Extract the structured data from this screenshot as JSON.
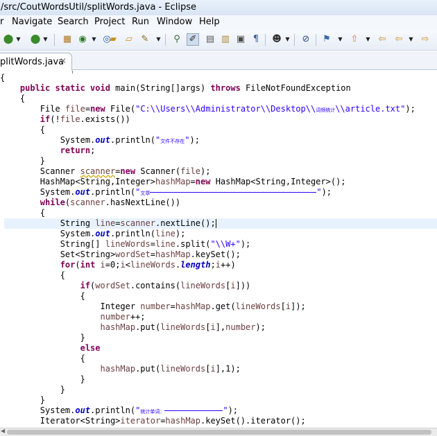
{
  "window": {
    "title": "/src/CoutWordsUtil/splitWords.java - Eclipse"
  },
  "menubar": {
    "items": [
      {
        "label": "r"
      },
      {
        "label": "Navigate"
      },
      {
        "label": "Search"
      },
      {
        "label": "Project"
      },
      {
        "label": "Run"
      },
      {
        "label": "Window"
      },
      {
        "label": "Help"
      }
    ]
  },
  "toolbar": {
    "icons": [
      "new-package-icon",
      "debug-icon",
      "run-icon",
      "new-java-project-icon",
      "new-class-icon",
      "open-folder-icon",
      "open-type-icon",
      "external-tools-icon",
      "toggle-breakpoint-icon",
      "mark-occurrences-icon",
      "open-resource-icon",
      "show-whitespace-icon",
      "block-selection-icon",
      "user-icon",
      "skip-breakpoints-icon",
      "pin-icon",
      "next-annotation-icon",
      "previous-annotation-icon",
      "back-icon",
      "forward-icon"
    ]
  },
  "tab": {
    "label": "plitWords.java",
    "close_glyph": "✕"
  },
  "code": {
    "lines": [
      [
        {
          "t": "{",
          "c": ""
        }
      ],
      [
        {
          "t": "    ",
          "c": ""
        },
        {
          "t": "public static void",
          "c": "kw"
        },
        {
          "t": " main(String[]args) ",
          "c": ""
        },
        {
          "t": "throws",
          "c": "kw"
        },
        {
          "t": " FileNotFoundException",
          "c": ""
        }
      ],
      [
        {
          "t": "    {",
          "c": ""
        }
      ],
      [
        {
          "t": "        File ",
          "c": ""
        },
        {
          "t": "file",
          "c": "var"
        },
        {
          "t": "=",
          "c": ""
        },
        {
          "t": "new",
          "c": "kw"
        },
        {
          "t": " File(",
          "c": ""
        },
        {
          "t": "\"C:\\\\Users\\\\Administrator\\\\Desktop\\\\",
          "c": "str"
        },
        {
          "t": "词频统计",
          "c": "str cjk"
        },
        {
          "t": "\\\\article.txt\"",
          "c": "str"
        },
        {
          "t": ");",
          "c": ""
        }
      ],
      [
        {
          "t": "        ",
          "c": ""
        },
        {
          "t": "if",
          "c": "kw"
        },
        {
          "t": "(!",
          "c": ""
        },
        {
          "t": "file",
          "c": "var"
        },
        {
          "t": ".exists())",
          "c": ""
        }
      ],
      [
        {
          "t": "        {",
          "c": ""
        }
      ],
      [
        {
          "t": "            System.",
          "c": ""
        },
        {
          "t": "out",
          "c": "fld"
        },
        {
          "t": ".println(",
          "c": ""
        },
        {
          "t": "\"",
          "c": "str"
        },
        {
          "t": "文件不存在",
          "c": "str cjk"
        },
        {
          "t": "\"",
          "c": "str"
        },
        {
          "t": ");",
          "c": ""
        }
      ],
      [
        {
          "t": "            ",
          "c": ""
        },
        {
          "t": "return",
          "c": "kw"
        },
        {
          "t": ";",
          "c": ""
        }
      ],
      [
        {
          "t": "        }",
          "c": ""
        }
      ],
      [
        {
          "t": "        Scanner ",
          "c": ""
        },
        {
          "t": "scanner",
          "c": "uvar"
        },
        {
          "t": "=",
          "c": ""
        },
        {
          "t": "new",
          "c": "kw"
        },
        {
          "t": " Scanner(",
          "c": ""
        },
        {
          "t": "file",
          "c": "var"
        },
        {
          "t": ");",
          "c": ""
        }
      ],
      [
        {
          "t": "        HashMap<String,Integer>",
          "c": ""
        },
        {
          "t": "hashMap",
          "c": "var"
        },
        {
          "t": "=",
          "c": ""
        },
        {
          "t": "new",
          "c": "kw"
        },
        {
          "t": " HashMap<String,Integer>();",
          "c": ""
        }
      ],
      [
        {
          "t": "        System.",
          "c": ""
        },
        {
          "t": "out",
          "c": "fld"
        },
        {
          "t": ".println(",
          "c": ""
        },
        {
          "t": "\"",
          "c": "str"
        },
        {
          "t": "文章",
          "c": "str cjk"
        },
        {
          "t": "",
          "c": "dash",
          "w": 240
        },
        {
          "t": "\"",
          "c": "str"
        },
        {
          "t": ");",
          "c": ""
        }
      ],
      [
        {
          "t": "        ",
          "c": ""
        },
        {
          "t": "while",
          "c": "kw"
        },
        {
          "t": "(",
          "c": ""
        },
        {
          "t": "scanner",
          "c": "var"
        },
        {
          "t": ".hasNextLine())",
          "c": ""
        }
      ],
      [
        {
          "t": "        {",
          "c": ""
        }
      ],
      [
        {
          "t": "            String ",
          "c": ""
        },
        {
          "t": "line",
          "c": "var"
        },
        {
          "t": "=",
          "c": ""
        },
        {
          "t": "scanner",
          "c": "var"
        },
        {
          "t": ".nextLine();",
          "c": ""
        },
        {
          "t": "",
          "c": "caret"
        }
      ],
      [
        {
          "t": "            System.",
          "c": ""
        },
        {
          "t": "out",
          "c": "fld"
        },
        {
          "t": ".println(",
          "c": ""
        },
        {
          "t": "line",
          "c": "var"
        },
        {
          "t": ");",
          "c": ""
        }
      ],
      [
        {
          "t": "            String[] ",
          "c": ""
        },
        {
          "t": "lineWords",
          "c": "var"
        },
        {
          "t": "=",
          "c": ""
        },
        {
          "t": "line",
          "c": "var"
        },
        {
          "t": ".split(",
          "c": ""
        },
        {
          "t": "\"\\\\W+\"",
          "c": "str"
        },
        {
          "t": ");",
          "c": ""
        }
      ],
      [
        {
          "t": "            Set<String>",
          "c": ""
        },
        {
          "t": "wordSet",
          "c": "var"
        },
        {
          "t": "=",
          "c": ""
        },
        {
          "t": "hashMap",
          "c": "var"
        },
        {
          "t": ".keySet();",
          "c": ""
        }
      ],
      [
        {
          "t": "            ",
          "c": ""
        },
        {
          "t": "for",
          "c": "kw"
        },
        {
          "t": "(",
          "c": ""
        },
        {
          "t": "int",
          "c": "kw"
        },
        {
          "t": " ",
          "c": ""
        },
        {
          "t": "i",
          "c": "var"
        },
        {
          "t": "=0;",
          "c": ""
        },
        {
          "t": "i",
          "c": "var"
        },
        {
          "t": "<",
          "c": ""
        },
        {
          "t": "lineWords",
          "c": "var"
        },
        {
          "t": ".",
          "c": ""
        },
        {
          "t": "length",
          "c": "fld"
        },
        {
          "t": ";",
          "c": ""
        },
        {
          "t": "i",
          "c": "var"
        },
        {
          "t": "++)",
          "c": ""
        }
      ],
      [
        {
          "t": "            {",
          "c": ""
        }
      ],
      [
        {
          "t": "                ",
          "c": ""
        },
        {
          "t": "if",
          "c": "kw"
        },
        {
          "t": "(",
          "c": ""
        },
        {
          "t": "wordSet",
          "c": "var"
        },
        {
          "t": ".contains(",
          "c": ""
        },
        {
          "t": "lineWords",
          "c": "var"
        },
        {
          "t": "[",
          "c": ""
        },
        {
          "t": "i",
          "c": "var"
        },
        {
          "t": "]))",
          "c": ""
        }
      ],
      [
        {
          "t": "                {",
          "c": ""
        }
      ],
      [
        {
          "t": "                    Integer ",
          "c": ""
        },
        {
          "t": "number",
          "c": "var"
        },
        {
          "t": "=",
          "c": ""
        },
        {
          "t": "hashMap",
          "c": "var"
        },
        {
          "t": ".get(",
          "c": ""
        },
        {
          "t": "lineWords",
          "c": "var"
        },
        {
          "t": "[",
          "c": ""
        },
        {
          "t": "i",
          "c": "var"
        },
        {
          "t": "]);",
          "c": ""
        }
      ],
      [
        {
          "t": "                    ",
          "c": ""
        },
        {
          "t": "number",
          "c": "var"
        },
        {
          "t": "++;",
          "c": ""
        }
      ],
      [
        {
          "t": "                    ",
          "c": ""
        },
        {
          "t": "hashMap",
          "c": "var"
        },
        {
          "t": ".put(",
          "c": ""
        },
        {
          "t": "lineWords",
          "c": "var"
        },
        {
          "t": "[",
          "c": ""
        },
        {
          "t": "i",
          "c": "var"
        },
        {
          "t": "],",
          "c": ""
        },
        {
          "t": "number",
          "c": "var"
        },
        {
          "t": ");",
          "c": ""
        }
      ],
      [
        {
          "t": "                }",
          "c": ""
        }
      ],
      [
        {
          "t": "                ",
          "c": ""
        },
        {
          "t": "else",
          "c": "kw"
        }
      ],
      [
        {
          "t": "                {",
          "c": ""
        }
      ],
      [
        {
          "t": "                    ",
          "c": ""
        },
        {
          "t": "hashMap",
          "c": "var"
        },
        {
          "t": ".put(",
          "c": ""
        },
        {
          "t": "lineWords",
          "c": "var"
        },
        {
          "t": "[",
          "c": ""
        },
        {
          "t": "i",
          "c": "var"
        },
        {
          "t": "],1);",
          "c": ""
        }
      ],
      [
        {
          "t": "                }",
          "c": ""
        }
      ],
      [
        {
          "t": "            }",
          "c": ""
        }
      ],
      [
        {
          "t": "        }",
          "c": ""
        }
      ],
      [
        {
          "t": "        System.",
          "c": ""
        },
        {
          "t": "out",
          "c": "fld"
        },
        {
          "t": ".println(",
          "c": ""
        },
        {
          "t": "\"",
          "c": "str"
        },
        {
          "t": "统计单词：",
          "c": "str cjk"
        },
        {
          "t": "",
          "c": "dash",
          "w": 84
        },
        {
          "t": "\"",
          "c": "str"
        },
        {
          "t": ");",
          "c": ""
        }
      ],
      [
        {
          "t": "        Iterator<String>",
          "c": ""
        },
        {
          "t": "iterator",
          "c": "var"
        },
        {
          "t": "=",
          "c": ""
        },
        {
          "t": "hashMap",
          "c": "var"
        },
        {
          "t": ".keySet().iterator();",
          "c": ""
        }
      ]
    ]
  }
}
